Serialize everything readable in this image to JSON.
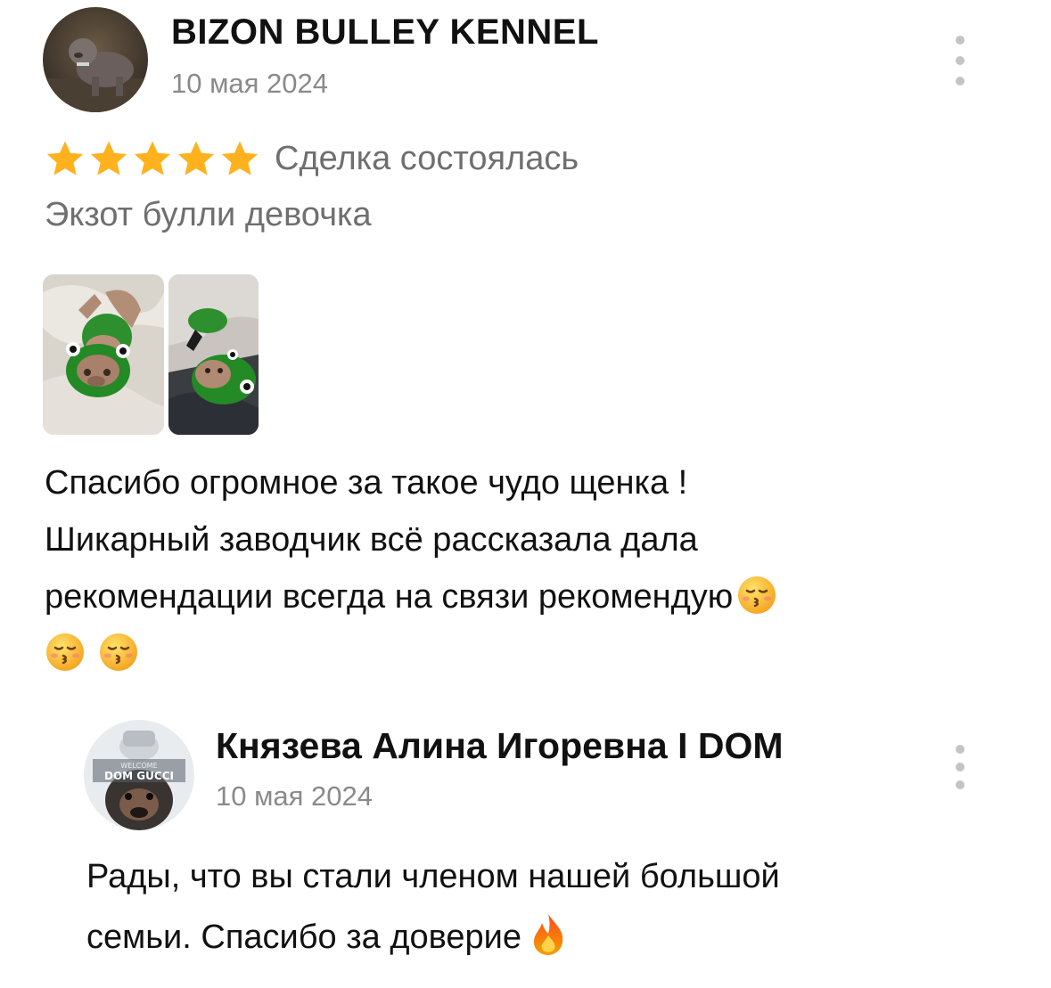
{
  "review": {
    "author_name": "BIZON BULLEY KENNEL",
    "date": "10 мая 2024",
    "rating": 5,
    "rating_max": 5,
    "deal_status": "Сделка состоялась",
    "subtitle": "Экзот булли девочка",
    "photos": [
      {
        "icon": "puppy-photo-1"
      },
      {
        "icon": "puppy-photo-2"
      }
    ],
    "text_lines": [
      "Спасибо огромное  за такое чудо  щенка !",
      "Шикарный заводчик всё рассказала  дала",
      "рекомендации  всегда на связи  рекомендую"
    ],
    "emojis": [
      "kissing-face-emoji",
      "kissing-face-emoji",
      "kissing-face-emoji"
    ],
    "star_color": "#FFB21E"
  },
  "reply": {
    "author_name": "Князева Алина Игоревна I DOM",
    "date": "10 мая 2024",
    "avatar_text": [
      "WELCOME",
      "DOM GUCCI"
    ],
    "text_lines": [
      "Рады, что вы стали членом нашей большой",
      "семьи. Спасибо за доверие"
    ],
    "emoji": "fire-emoji"
  }
}
